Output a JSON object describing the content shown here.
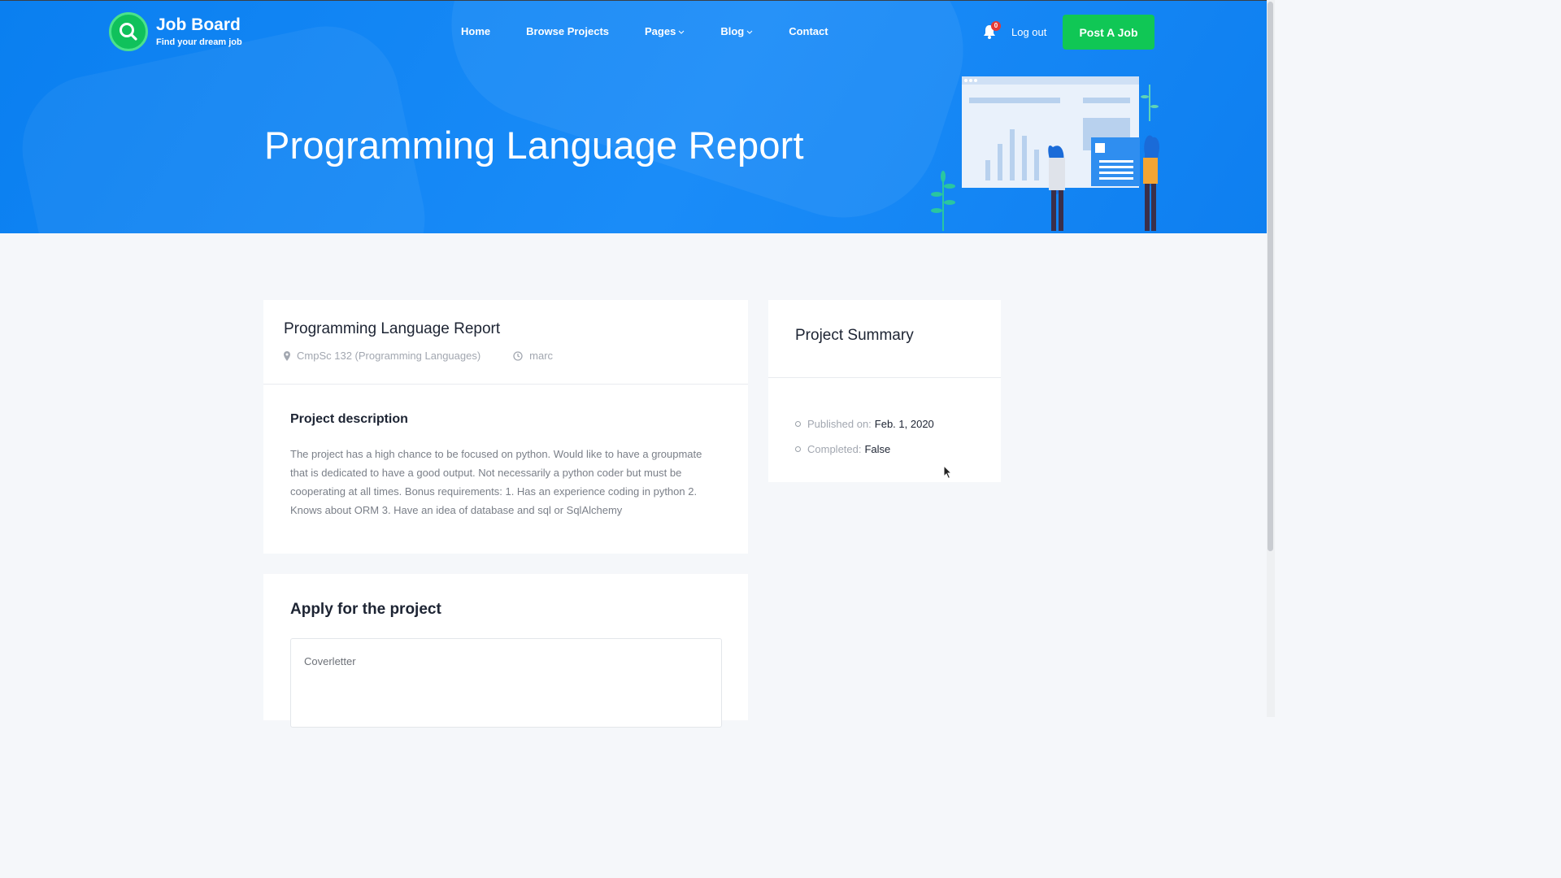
{
  "brand": {
    "title": "Job Board",
    "tagline": "Find your dream job"
  },
  "nav": {
    "items": [
      {
        "label": "Home"
      },
      {
        "label": "Browse Projects"
      },
      {
        "label": "Pages"
      },
      {
        "label": "Blog"
      },
      {
        "label": "Contact"
      }
    ],
    "notification_count": "0",
    "logout_label": "Log out",
    "post_job_label": "Post A Job"
  },
  "hero": {
    "title": "Programming Language Report"
  },
  "project": {
    "title": "Programming Language Report",
    "course": "CmpSc 132 (Programming Languages)",
    "owner": "marc",
    "description_heading": "Project description",
    "description": "The project has a high chance to be focused on python. Would like to have a groupmate that is dedicated to have a good output. Not necessarily a python coder but must be cooperating at all times. Bonus requirements: 1. Has an experience coding in python 2. Knows about ORM 3. Have an idea of database and sql or SqlAlchemy"
  },
  "apply": {
    "heading": "Apply for the project",
    "coverletter_placeholder": "Coverletter"
  },
  "summary": {
    "heading": "Project Summary",
    "items": [
      {
        "label": "Published on:",
        "value": "Feb. 1, 2020"
      },
      {
        "label": "Completed:",
        "value": "False"
      }
    ]
  },
  "colors": {
    "hero_blue": "#1a8cf8",
    "accent_green": "#10c755",
    "badge_red": "#e53935",
    "page_bg": "#f5f7fa"
  },
  "icons": [
    "search-icon",
    "chevron-down-icon",
    "bell-icon",
    "map-pin-icon",
    "clock-icon",
    "mouse-cursor-icon"
  ]
}
